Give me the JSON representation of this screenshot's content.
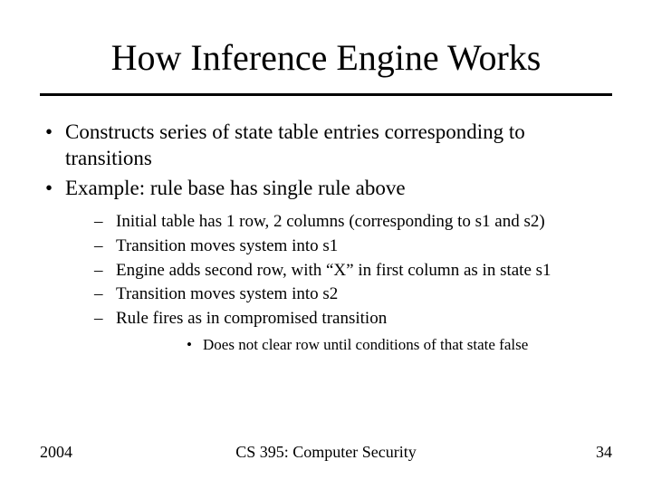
{
  "title": "How Inference Engine Works",
  "bullets": {
    "b0": "Constructs series of state table entries corresponding to transitions",
    "b1": "Example: rule base has single rule above"
  },
  "subbullets": {
    "s0": "Initial table has 1 row, 2 columns (corresponding to s1 and s2)",
    "s1": "Transition moves system into s1",
    "s2": "Engine adds second row, with “X” in first column as in state s1",
    "s3": "Transition moves system into s2",
    "s4": "Rule fires as in compromised transition"
  },
  "subsub": {
    "ss0": "Does not clear row until conditions of that state false"
  },
  "footer": {
    "left": "2004",
    "center": "CS 395: Computer Security",
    "right": "34"
  }
}
